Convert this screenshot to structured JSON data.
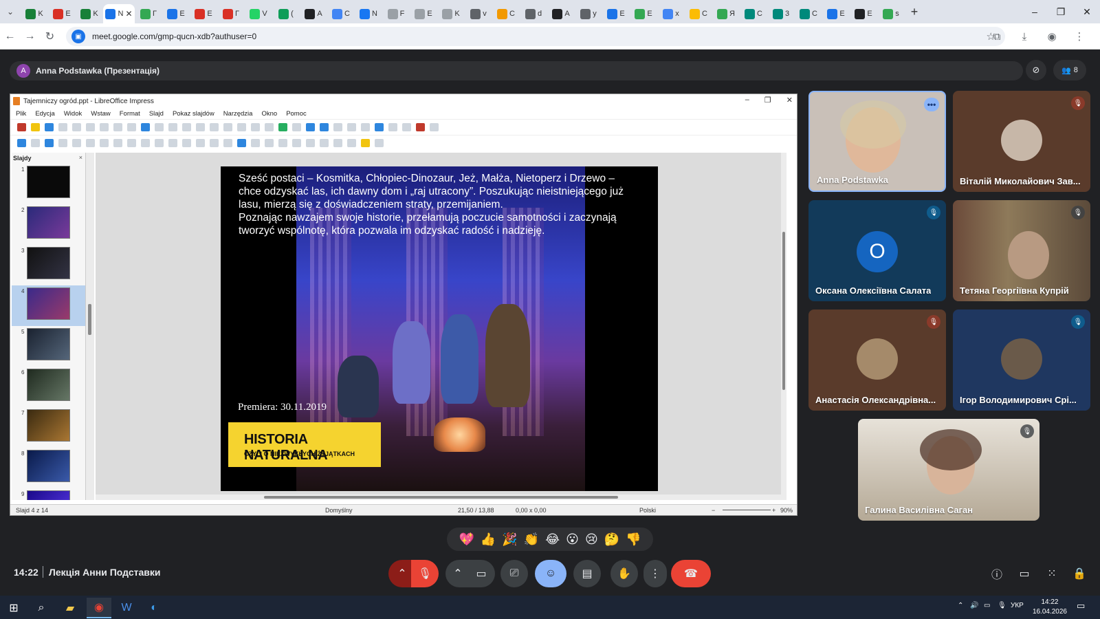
{
  "browser": {
    "tabs": [
      {
        "label": "K",
        "color": "#188038"
      },
      {
        "label": "E",
        "color": "#d93025"
      },
      {
        "label": "K",
        "color": "#188038"
      },
      {
        "label": "N",
        "color": "#1a73e8"
      },
      {
        "label": "Г",
        "color": "#34a853"
      },
      {
        "label": "Е",
        "color": "#1a73e8"
      },
      {
        "label": "E",
        "color": "#d93025"
      },
      {
        "label": "Г",
        "color": "#d93025"
      },
      {
        "label": "V",
        "color": "#25d366"
      },
      {
        "label": "(",
        "color": "#0f9d58"
      },
      {
        "label": "A",
        "color": "#202124"
      },
      {
        "label": "C",
        "color": "#4285f4"
      },
      {
        "label": "N",
        "color": "#1877f2"
      },
      {
        "label": "F",
        "color": "#9aa0a6"
      },
      {
        "label": "E",
        "color": "#9aa0a6"
      },
      {
        "label": "K",
        "color": "#9aa0a6"
      },
      {
        "label": "v",
        "color": "#5f6368"
      },
      {
        "label": "C",
        "color": "#f29900"
      },
      {
        "label": "d",
        "color": "#5f6368"
      },
      {
        "label": "A",
        "color": "#202124"
      },
      {
        "label": "y",
        "color": "#5f6368"
      },
      {
        "label": "E",
        "color": "#1a73e8"
      },
      {
        "label": "E",
        "color": "#34a853"
      },
      {
        "label": "x",
        "color": "#4285f4"
      },
      {
        "label": "C",
        "color": "#fbbc04"
      },
      {
        "label": "Я",
        "color": "#34a853"
      },
      {
        "label": "C",
        "color": "#00897b"
      },
      {
        "label": "3",
        "color": "#00897b"
      },
      {
        "label": "C",
        "color": "#00897b"
      },
      {
        "label": "E",
        "color": "#1a73e8"
      },
      {
        "label": "E",
        "color": "#202124"
      },
      {
        "label": "s",
        "color": "#34a853"
      }
    ],
    "active_tab_index": 3,
    "url": "meet.google.com/gmp-qucn-xdb?authuser=0"
  },
  "meet": {
    "presenter_initial": "A",
    "presenter_label": "Anna Podstawka (Презентація)",
    "participant_count": "8",
    "clock": "14:22",
    "meeting_title": "Лекція Анни Подставки",
    "reactions": [
      "💖",
      "👍",
      "🎉",
      "👏",
      "😂",
      "😮",
      "😢",
      "🤔",
      "👎"
    ],
    "participants": [
      {
        "name": "Anna Podstawka"
      },
      {
        "name": "Віталій Миколайович Зав..."
      },
      {
        "name": "Оксана Олексіївна Салата",
        "initial": "О"
      },
      {
        "name": "Тетяна Георгіївна Купрій"
      },
      {
        "name": "Анастасія Олександрівна..."
      },
      {
        "name": "Ігор Володимирович Срі..."
      },
      {
        "name": "Галина Василівна Саган"
      }
    ]
  },
  "impress": {
    "window_title": "Tajemniczy ogród.ppt - LibreOffice Impress",
    "menu": [
      "Plik",
      "Edycja",
      "Widok",
      "Wstaw",
      "Format",
      "Slajd",
      "Pokaz slajdów",
      "Narzędzia",
      "Okno",
      "Pomoc"
    ],
    "slides_panel_title": "Slajdy",
    "slide_numbers": [
      "1",
      "2",
      "3",
      "4",
      "5",
      "6",
      "7",
      "8",
      "9"
    ],
    "selected_slide": 4,
    "slide": {
      "text": "Sześć postaci – Kosmitka, Chłopiec-Dinozaur, Jeż, Małża, Nietoperz i Drzewo – chce odzyskać las, ich dawny dom i „raj utracony”. Poszukując nieistniejącego już lasu, mierzą się z doświadczeniem straty, przemijaniem.\nPoznając nawzajem swoje historie, przełamują poczucie samotności i zaczynają tworzyć wspólnotę, która pozwala im odzyskać radość i nadzieję.",
      "premiere": "Premiera: 30.11.2019",
      "banner_title": "HISTORIA NATURALNA",
      "banner_subtitle": "CZYLI O NIEZWYKŁYCH ŻYJĄTKACH"
    },
    "status": {
      "slide_info": "Slajd 4 z 14",
      "layout": "Domyślny",
      "position": "21,50 / 13,88",
      "size": "0,00 x 0,00",
      "language": "Polski",
      "zoom": "90%"
    }
  },
  "taskbar": {
    "lang": "УКР",
    "time": "14:22",
    "date": "16.04.2026"
  }
}
